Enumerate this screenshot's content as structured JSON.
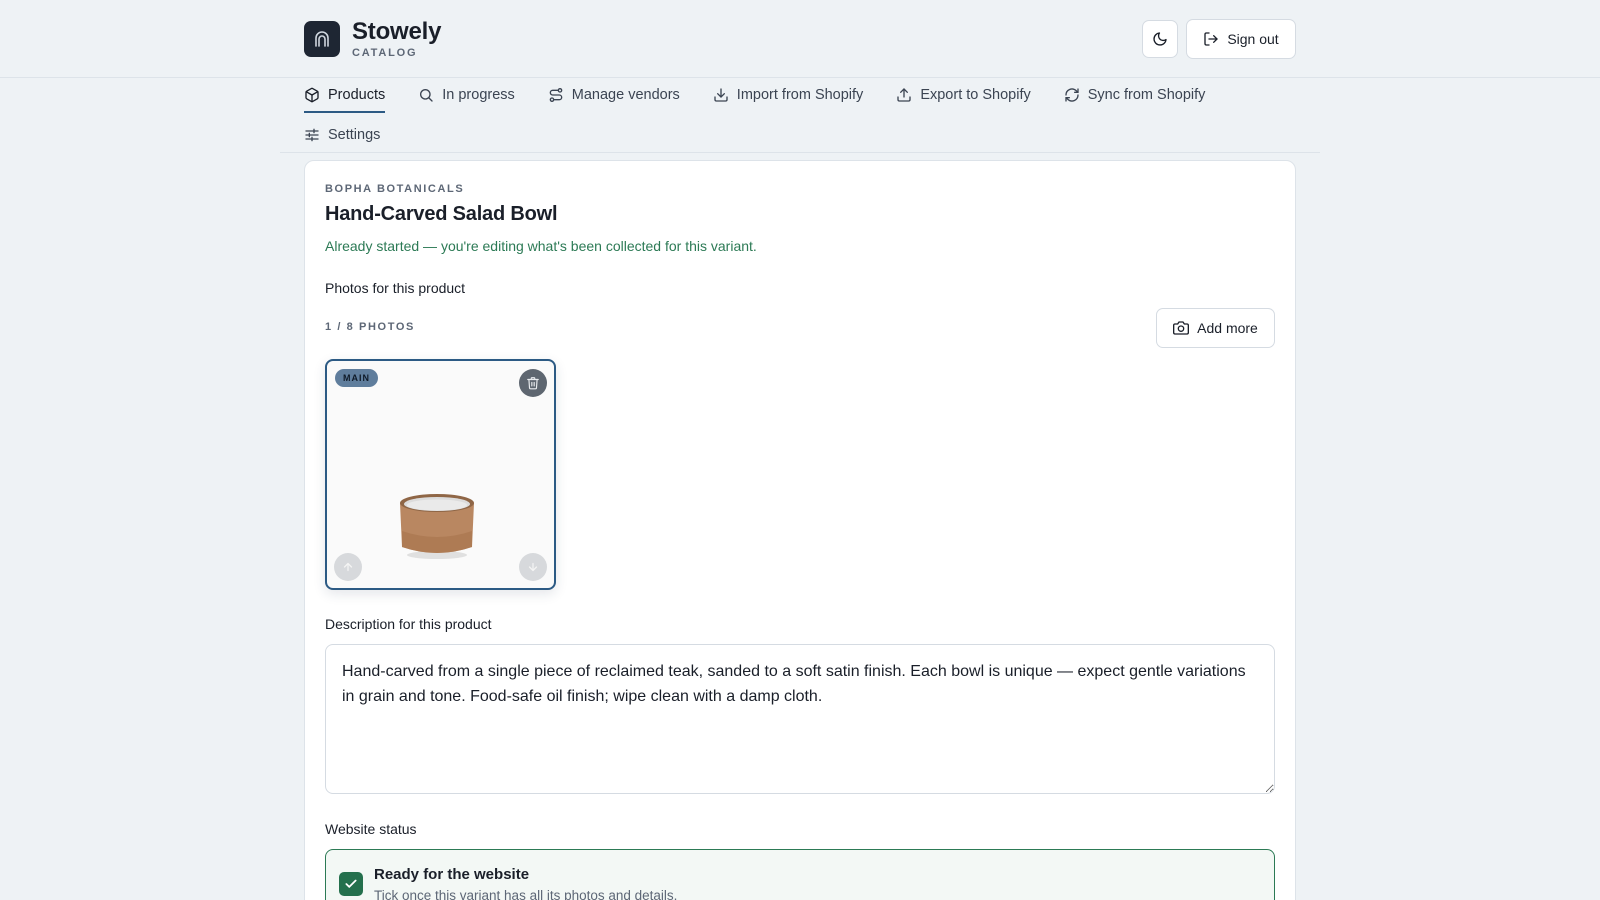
{
  "app": {
    "name": "Stowely",
    "subtitle": "CATALOG",
    "sign_out_label": "Sign out"
  },
  "icons": {
    "logo": "archway-icon",
    "theme": "moon-icon",
    "sign_out": "sign-out-icon"
  },
  "nav": {
    "tabs": [
      {
        "label": "Products",
        "icon": "box-icon",
        "active": true
      },
      {
        "label": "In progress",
        "icon": "search-icon",
        "active": false
      },
      {
        "label": "Manage vendors",
        "icon": "route-icon",
        "active": false
      },
      {
        "label": "Import from Shopify",
        "icon": "download-icon",
        "active": false
      },
      {
        "label": "Export to Shopify",
        "icon": "upload-icon",
        "active": false
      },
      {
        "label": "Sync from Shopify",
        "icon": "refresh-icon",
        "active": false
      },
      {
        "label": "Settings",
        "icon": "sliders-icon",
        "active": false
      }
    ]
  },
  "product": {
    "vendor": "BOPHA BOTANICALS",
    "title": "Hand-Carved Salad Bowl",
    "notice": "Already started — you're editing what's been collected for this variant."
  },
  "photos": {
    "label": "Photos for this product",
    "count": "1 / 8 PHOTOS",
    "add_more_label": "Add more",
    "items": [
      {
        "badge": "MAIN"
      }
    ]
  },
  "description": {
    "label": "Description for this product",
    "value": "Hand-carved from a single piece of reclaimed teak, sanded to a soft satin finish. Each bowl is unique — expect gentle variations in grain and tone. Food-safe oil finish; wipe clean with a damp cloth."
  },
  "website_status": {
    "label": "Website status",
    "checked": true,
    "title": "Ready for the website",
    "subtitle": "Tick once this variant has all its photos and details."
  },
  "colors": {
    "accent": "#2c5a84",
    "success": "#2c7a55",
    "background": "#eef2f5"
  }
}
